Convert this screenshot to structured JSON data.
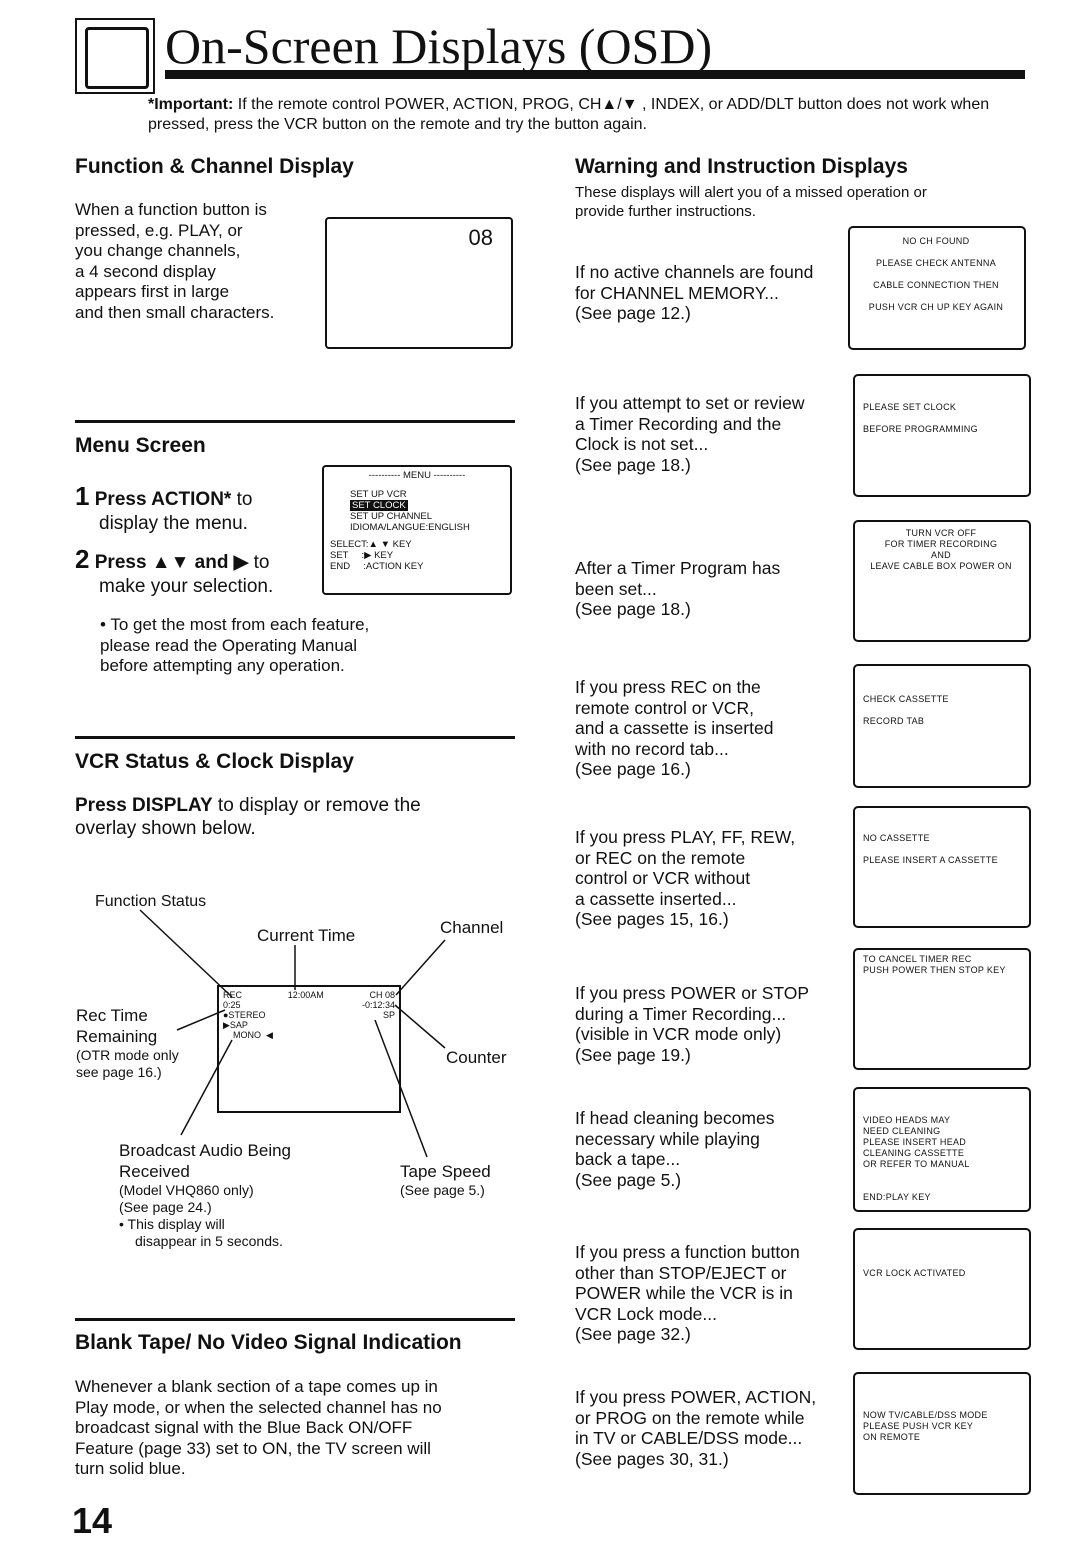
{
  "header": {
    "title": "On-Screen Displays (OSD)",
    "important_label": "*Important:",
    "important_text": "If the remote control POWER, ACTION, PROG, CH▲/▼ , INDEX, or ADD/DLT button does not work when pressed, press the VCR button on the remote and try the button again."
  },
  "function_channel": {
    "heading": "Function & Channel Display",
    "text": [
      "When a function button is",
      "pressed, e.g. PLAY, or",
      "you change channels,",
      "a 4 second display",
      "appears first in large",
      "and then small characters."
    ],
    "display": "08"
  },
  "menu_screen": {
    "heading": "Menu Screen",
    "step1_num": "1",
    "step1_bold": "Press ACTION*",
    "step1_rest": " to",
    "step1_line2": "display the menu.",
    "step2_num": "2",
    "step2_bold": "Press ▲▼ and ▶",
    "step2_rest": " to",
    "step2_line2": "make your selection.",
    "note": [
      "• To get the most from each feature,",
      "please read the Operating Manual",
      "before attempting any operation."
    ],
    "menu": {
      "title": "---------- MENU ----------",
      "items": [
        "SET UP VCR",
        "SET CLOCK",
        "SET UP CHANNEL",
        "IDIOMA/LANGUE:ENGLISH"
      ],
      "keys": [
        "SELECT:▲ ▼ KEY",
        "SET     :▶ KEY",
        "END     :ACTION KEY"
      ]
    }
  },
  "vcr_status": {
    "heading": "VCR Status & Clock Display",
    "intro_bold": "Press DISPLAY",
    "intro_rest": " to display or remove the",
    "intro_line2": "overlay shown below.",
    "labels": {
      "function_status": "Function Status",
      "current_time": "Current Time",
      "channel": "Channel",
      "rec_time": "Rec Time",
      "remaining": "Remaining",
      "otr1": "(OTR mode only",
      "otr2": "see page 16.)",
      "counter": "Counter",
      "broadcast1": "Broadcast Audio Being",
      "broadcast2": "Received",
      "broadcast3": "(Model VHQ860 only)",
      "broadcast4": "(See page 24.)",
      "tape_speed": "Tape Speed",
      "tape_page": "(See page 5.)",
      "note1": "• This display will",
      "note2": "disappear in 5 seconds."
    },
    "osd": {
      "rec": "REC",
      "time": "12:00AM",
      "ch": "CH 08",
      "remain": "0:25",
      "counter": "-0:12:34",
      "stereo": "●STEREO",
      "speed": "SP",
      "sap": "▶SAP",
      "mono": "MONO  ◀"
    }
  },
  "blank_tape": {
    "heading": "Blank Tape/ No Video Signal Indication",
    "text": [
      "Whenever a blank section of a tape comes up in",
      "Play mode, or when the selected channel has no",
      "broadcast signal with the Blue Back ON/OFF",
      "Feature (page 33) set to ON, the TV screen will",
      "turn solid blue."
    ]
  },
  "warnings": {
    "heading": "Warning and Instruction Displays",
    "intro": [
      "These displays will alert you of a missed operation or",
      "provide further instructions."
    ],
    "items": [
      {
        "text": [
          "If no active channels are found",
          "for CHANNEL MEMORY...",
          "(See page 12.)"
        ],
        "screen": [
          "NO CH FOUND",
          "PLEASE CHECK ANTENNA",
          "CABLE CONNECTION THEN",
          "PUSH VCR CH UP KEY AGAIN"
        ]
      },
      {
        "text": [
          "If you attempt to set or review",
          "a Timer Recording and the",
          "Clock is not set...",
          "(See page 18.)"
        ],
        "screen": [
          "PLEASE SET CLOCK",
          "BEFORE PROGRAMMING"
        ]
      },
      {
        "text": [
          "After a Timer Program has",
          "been set...",
          "(See page 18.)"
        ],
        "screen": [
          "TURN VCR OFF",
          "FOR TIMER RECORDING",
          "AND",
          "LEAVE CABLE BOX POWER ON"
        ]
      },
      {
        "text": [
          "If you press REC on the",
          "remote control or VCR,",
          "and a cassette is inserted",
          "with no record tab...",
          "(See page 16.)"
        ],
        "screen": [
          "CHECK CASSETTE",
          "RECORD TAB"
        ]
      },
      {
        "text": [
          "If you press PLAY, FF, REW,",
          "or REC on the remote",
          "control or VCR without",
          "a cassette inserted...",
          "(See pages 15, 16.)"
        ],
        "screen": [
          "NO CASSETTE",
          "PLEASE INSERT A CASSETTE"
        ]
      },
      {
        "text": [
          "If you press POWER or STOP",
          "during a Timer Recording...",
          "(visible in VCR mode only)",
          "(See page 19.)"
        ],
        "screen": [
          "TO CANCEL TIMER REC",
          "PUSH POWER THEN STOP KEY"
        ]
      },
      {
        "text": [
          "If head cleaning becomes",
          "necessary while playing",
          "back a tape...",
          "(See page 5.)"
        ],
        "screen": [
          "VIDEO HEADS MAY",
          "NEED CLEANING",
          "PLEASE INSERT HEAD",
          "CLEANING CASSETTE",
          "OR REFER TO MANUAL",
          "END:PLAY KEY"
        ]
      },
      {
        "text": [
          "If you press a function button",
          "other than STOP/EJECT or",
          "POWER while the VCR is in",
          "VCR Lock mode...",
          "(See page 32.)"
        ],
        "screen": [
          "VCR LOCK ACTIVATED"
        ]
      },
      {
        "text": [
          "If you press POWER, ACTION,",
          "or PROG on the remote while",
          "in TV or CABLE/DSS mode...",
          "(See pages 30, 31.)"
        ],
        "screen": [
          "NOW TV/CABLE/DSS MODE",
          "PLEASE PUSH VCR KEY",
          "ON REMOTE"
        ]
      }
    ]
  },
  "page_number": "14"
}
